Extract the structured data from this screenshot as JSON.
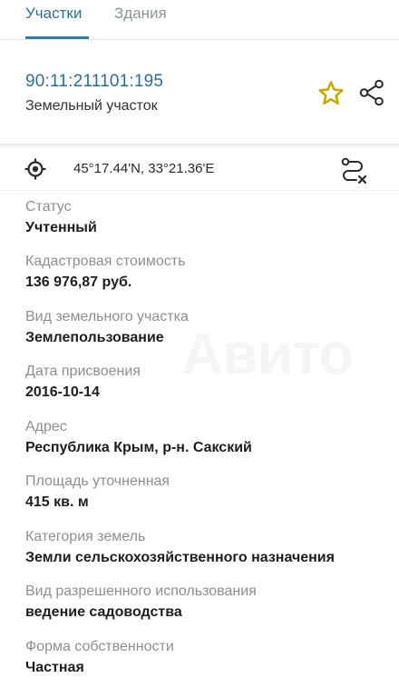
{
  "tabs": [
    {
      "label": "Участки",
      "active": true
    },
    {
      "label": "Здания",
      "active": false
    }
  ],
  "object": {
    "cadastral_number": "90:11:211101:195",
    "type": "Земельный участок"
  },
  "icons": {
    "favorite": "star-icon",
    "share": "share-icon",
    "locate": "crosshair-icon",
    "route": "route-icon"
  },
  "colors": {
    "accent": "#2f6f8c",
    "star": "#c9a800"
  },
  "coordinates": "45°17.44'N, 33°21.36'E",
  "fields": [
    {
      "label": "Статус",
      "value": "Учтенный"
    },
    {
      "label": "Кадастровая стоимость",
      "value": "136 976,87 руб."
    },
    {
      "label": "Вид земельного участка",
      "value": "Землепользование"
    },
    {
      "label": "Дата присвоения",
      "value": "2016-10-14"
    },
    {
      "label": "Адрес",
      "value": "Республика Крым, р-н. Сакский"
    },
    {
      "label": "Площадь уточненная",
      "value": "415 кв. м"
    },
    {
      "label": "Категория земель",
      "value": "Земли сельскохозяйственного назначения"
    },
    {
      "label": "Вид разрешенного использования",
      "value": "ведение садоводства"
    },
    {
      "label": "Форма собственности",
      "value": "Частная"
    }
  ]
}
